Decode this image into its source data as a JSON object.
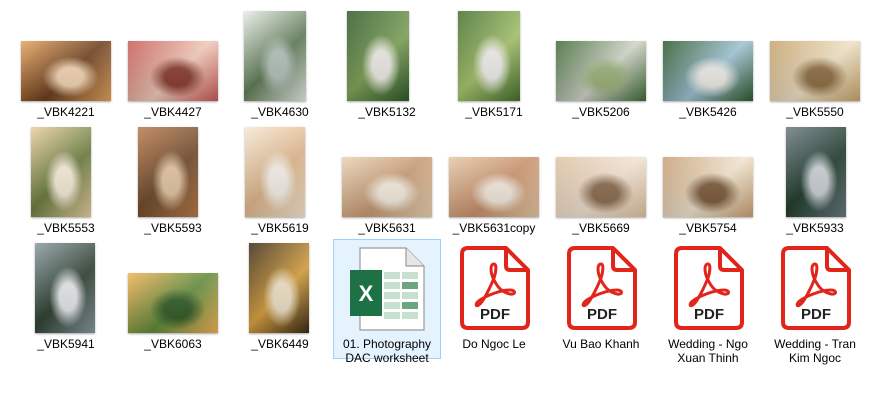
{
  "files": [
    {
      "name": "_VBK4221",
      "type": "photo",
      "colors": [
        "#e5a35e",
        "#6b3d1c",
        "#f6d7b3"
      ]
    },
    {
      "name": "_VBK4427",
      "type": "photo",
      "colors": [
        "#c95a56",
        "#f0c9b8",
        "#8a3a2c"
      ]
    },
    {
      "name": "_VBK4630",
      "type": "photo",
      "colors": [
        "#e8ece8",
        "#5f7c56",
        "#b6c4bd"
      ]
    },
    {
      "name": "_VBK5132",
      "type": "photo",
      "colors": [
        "#2f5a2b",
        "#7fa257",
        "#f2f0ea"
      ]
    },
    {
      "name": "_VBK5171",
      "type": "photo",
      "colors": [
        "#456f2e",
        "#a6c46b",
        "#f4f3ef"
      ]
    },
    {
      "name": "_VBK5206",
      "type": "photo",
      "colors": [
        "#3f6a34",
        "#cfd3c7",
        "#9bb37a"
      ]
    },
    {
      "name": "_VBK5426",
      "type": "photo",
      "colors": [
        "#2e5a2a",
        "#9ec2d6",
        "#f0efe9"
      ]
    },
    {
      "name": "_VBK5550",
      "type": "photo",
      "colors": [
        "#c8a46b",
        "#efe1c4",
        "#8f6e42"
      ]
    },
    {
      "name": "_VBK5553",
      "type": "photo",
      "colors": [
        "#e9cfa1",
        "#6a7c3c",
        "#fbf1dd"
      ]
    },
    {
      "name": "_VBK5593",
      "type": "photo",
      "colors": [
        "#b97a4a",
        "#6e4a2c",
        "#e7c9a4"
      ]
    },
    {
      "name": "_VBK5619",
      "type": "photo",
      "colors": [
        "#f5e7d2",
        "#e0b78b",
        "#fbf6ee"
      ]
    },
    {
      "name": "_VBK5631",
      "type": "photo",
      "colors": [
        "#e9d2b4",
        "#c79a72",
        "#f8efe2"
      ]
    },
    {
      "name": "_VBK5631copy",
      "type": "photo",
      "colors": [
        "#e5c8a6",
        "#c8916a",
        "#f7ecdf"
      ]
    },
    {
      "name": "_VBK5669",
      "type": "photo",
      "colors": [
        "#dfc4a2",
        "#f2e2d1",
        "#8b6b4f"
      ]
    },
    {
      "name": "_VBK5754",
      "type": "photo",
      "colors": [
        "#c9a175",
        "#f1e4cf",
        "#7d5b3a"
      ]
    },
    {
      "name": "_VBK5933",
      "type": "photo",
      "colors": [
        "#6b7a83",
        "#1f3b2a",
        "#cfd6d9"
      ]
    },
    {
      "name": "_VBK5941",
      "type": "photo",
      "colors": [
        "#8a9aa3",
        "#2d3f2e",
        "#e9ecee"
      ]
    },
    {
      "name": "_VBK6063",
      "type": "photo",
      "colors": [
        "#f2b356",
        "#5e8a3a",
        "#2f5a24"
      ]
    },
    {
      "name": "_VBK6449",
      "type": "photo",
      "colors": [
        "#3b2b17",
        "#d8a13e",
        "#f3e6c9"
      ]
    },
    {
      "name": "01. Photography DAC worksheet",
      "type": "excel",
      "line1": "01. Photography",
      "line2": "DAC worksheet"
    },
    {
      "name": "Do Ngoc Le",
      "type": "pdf",
      "line1": "Do Ngoc Le",
      "line2": ""
    },
    {
      "name": "Vu Bao Khanh",
      "type": "pdf",
      "line1": "Vu Bao Khanh",
      "line2": ""
    },
    {
      "name": "Wedding - Ngo Xuan Thinh",
      "type": "pdf",
      "line1": "Wedding - Ngo",
      "line2": "Xuan Thinh"
    },
    {
      "name": "Wedding - Tran Kim Ngoc",
      "type": "pdf",
      "line1": "Wedding - Tran",
      "line2": "Kim Ngoc"
    }
  ],
  "icons": {
    "excel_letter": "X",
    "pdf_label": "PDF"
  },
  "colors": {
    "excel_green": "#1e7145",
    "pdf_red": "#e1251b",
    "selection": "#e5f3ff"
  }
}
